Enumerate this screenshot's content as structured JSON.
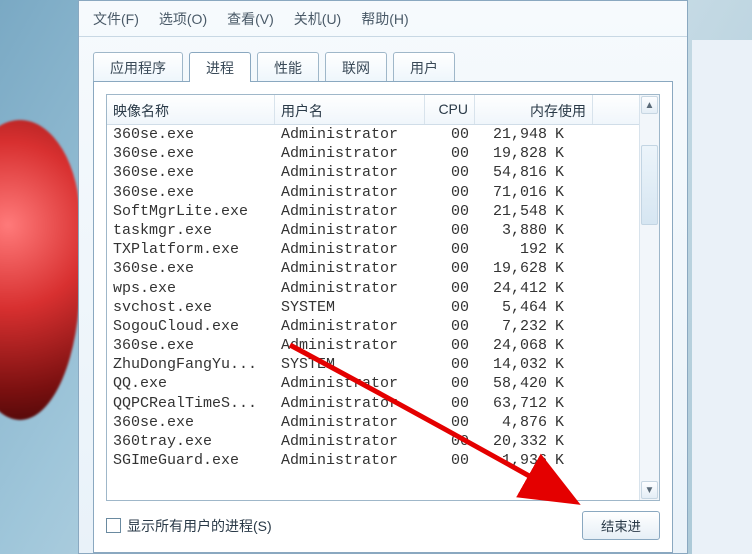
{
  "menu": {
    "file": "文件(F)",
    "options": "选项(O)",
    "view": "查看(V)",
    "shutdown": "关机(U)",
    "help": "帮助(H)"
  },
  "tabs": {
    "apps": "应用程序",
    "processes": "进程",
    "performance": "性能",
    "networking": "联网",
    "users": "用户"
  },
  "columns": {
    "name": "映像名称",
    "user": "用户名",
    "cpu": "CPU",
    "mem": "内存使用"
  },
  "mem_unit": "K",
  "processes": [
    {
      "name": "360se.exe",
      "user": "Administrator",
      "cpu": "00",
      "mem": "21,948"
    },
    {
      "name": "360se.exe",
      "user": "Administrator",
      "cpu": "00",
      "mem": "19,828"
    },
    {
      "name": "360se.exe",
      "user": "Administrator",
      "cpu": "00",
      "mem": "54,816"
    },
    {
      "name": "360se.exe",
      "user": "Administrator",
      "cpu": "00",
      "mem": "71,016"
    },
    {
      "name": "SoftMgrLite.exe",
      "user": "Administrator",
      "cpu": "00",
      "mem": "21,548"
    },
    {
      "name": "taskmgr.exe",
      "user": "Administrator",
      "cpu": "00",
      "mem": "3,880"
    },
    {
      "name": "TXPlatform.exe",
      "user": "Administrator",
      "cpu": "00",
      "mem": "192"
    },
    {
      "name": "360se.exe",
      "user": "Administrator",
      "cpu": "00",
      "mem": "19,628"
    },
    {
      "name": "wps.exe",
      "user": "Administrator",
      "cpu": "00",
      "mem": "24,412"
    },
    {
      "name": "svchost.exe",
      "user": "SYSTEM",
      "cpu": "00",
      "mem": "5,464"
    },
    {
      "name": "SogouCloud.exe",
      "user": "Administrator",
      "cpu": "00",
      "mem": "7,232"
    },
    {
      "name": "360se.exe",
      "user": "Administrator",
      "cpu": "00",
      "mem": "24,068"
    },
    {
      "name": "ZhuDongFangYu...",
      "user": "SYSTEM",
      "cpu": "00",
      "mem": "14,032"
    },
    {
      "name": "QQ.exe",
      "user": "Administrator",
      "cpu": "00",
      "mem": "58,420"
    },
    {
      "name": "QQPCRealTimeS...",
      "user": "Administrator",
      "cpu": "00",
      "mem": "63,712"
    },
    {
      "name": "360se.exe",
      "user": "Administrator",
      "cpu": "00",
      "mem": "4,876"
    },
    {
      "name": "360tray.exe",
      "user": "Administrator",
      "cpu": "00",
      "mem": "20,332"
    },
    {
      "name": "SGImeGuard.exe",
      "user": "Administrator",
      "cpu": "00",
      "mem": "1,936"
    }
  ],
  "show_all": "显示所有用户的进程(S)",
  "end_process": "结束进"
}
